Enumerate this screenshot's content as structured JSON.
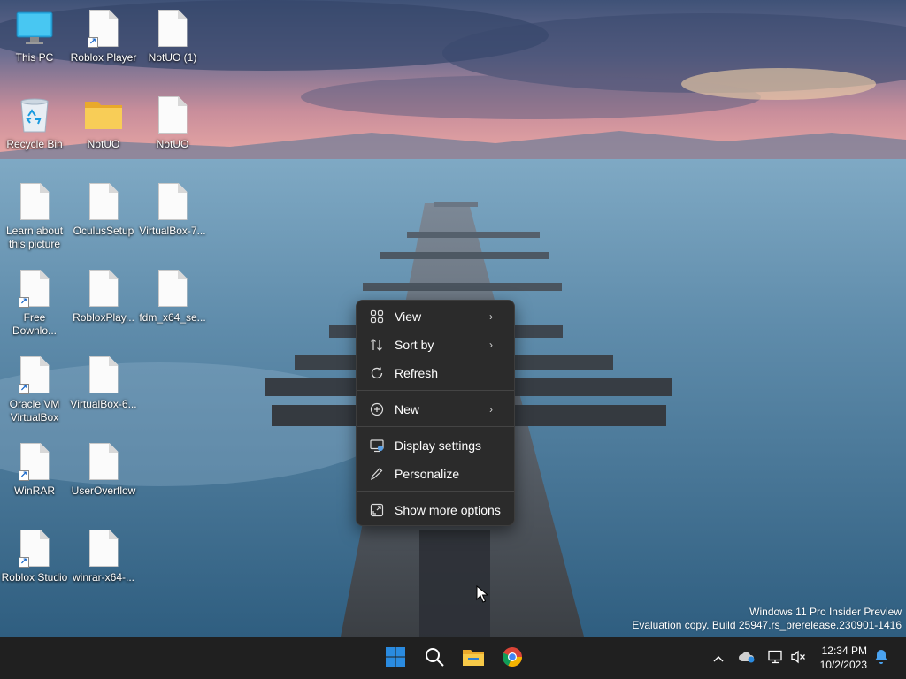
{
  "desktop": {
    "icons": [
      {
        "label": "This PC",
        "kind": "pc-icon"
      },
      {
        "label": "Roblox Player",
        "kind": "document-icon",
        "shortcut": true
      },
      {
        "label": "NotUO (1)",
        "kind": "document-icon"
      },
      {
        "label": "Recycle Bin",
        "kind": "recycle-bin-icon"
      },
      {
        "label": "NotUO",
        "kind": "folder-icon"
      },
      {
        "label": "NotUO",
        "kind": "document-icon"
      },
      {
        "label": "Learn about this picture",
        "kind": "document-icon"
      },
      {
        "label": "OculusSetup",
        "kind": "document-icon"
      },
      {
        "label": "VirtualBox-7...",
        "kind": "document-icon"
      },
      {
        "label": "Free Downlo...",
        "kind": "document-icon",
        "shortcut": true
      },
      {
        "label": "RobloxPlay...",
        "kind": "document-icon"
      },
      {
        "label": "fdm_x64_se...",
        "kind": "document-icon"
      },
      {
        "label": "Oracle VM VirtualBox",
        "kind": "document-icon",
        "shortcut": true
      },
      {
        "label": "VirtualBox-6...",
        "kind": "document-icon"
      },
      {
        "label": "WinRAR",
        "kind": "document-icon",
        "shortcut": true
      },
      {
        "label": "UserOverflow",
        "kind": "document-icon"
      },
      {
        "label": "Roblox Studio",
        "kind": "document-icon",
        "shortcut": true
      },
      {
        "label": "winrar-x64-...",
        "kind": "document-icon"
      }
    ]
  },
  "context_menu": {
    "items": [
      {
        "label": "View",
        "icon": "view-grid-icon",
        "submenu": true
      },
      {
        "label": "Sort by",
        "icon": "sort-icon",
        "submenu": true
      },
      {
        "label": "Refresh",
        "icon": "refresh-icon",
        "submenu": false
      },
      {
        "label": "New",
        "icon": "new-plus-icon",
        "submenu": true
      },
      {
        "label": "Display settings",
        "icon": "display-settings-icon",
        "submenu": false
      },
      {
        "label": "Personalize",
        "icon": "pen-icon",
        "submenu": false
      },
      {
        "label": "Show more options",
        "icon": "expand-icon",
        "submenu": false
      }
    ],
    "arrow_glyph": "›"
  },
  "watermark": {
    "line1": "Windows 11 Pro Insider Preview",
    "line2": "Evaluation copy. Build 25947.rs_prerelease.230901-1416"
  },
  "taskbar": {
    "clock": {
      "time": "12:34 PM",
      "date": "10/2/2023"
    },
    "pinned": [
      "start-icon",
      "search-icon",
      "file-explorer-icon",
      "chrome-icon"
    ],
    "tray": [
      "chevron-up-icon",
      "onedrive-icon",
      "network-icon",
      "volume-muted-icon",
      "notification-bell-icon"
    ],
    "colors": {
      "accent": "#0078d4",
      "taskbar_bg": "#202020",
      "menu_bg": "#2b2b2b"
    }
  }
}
